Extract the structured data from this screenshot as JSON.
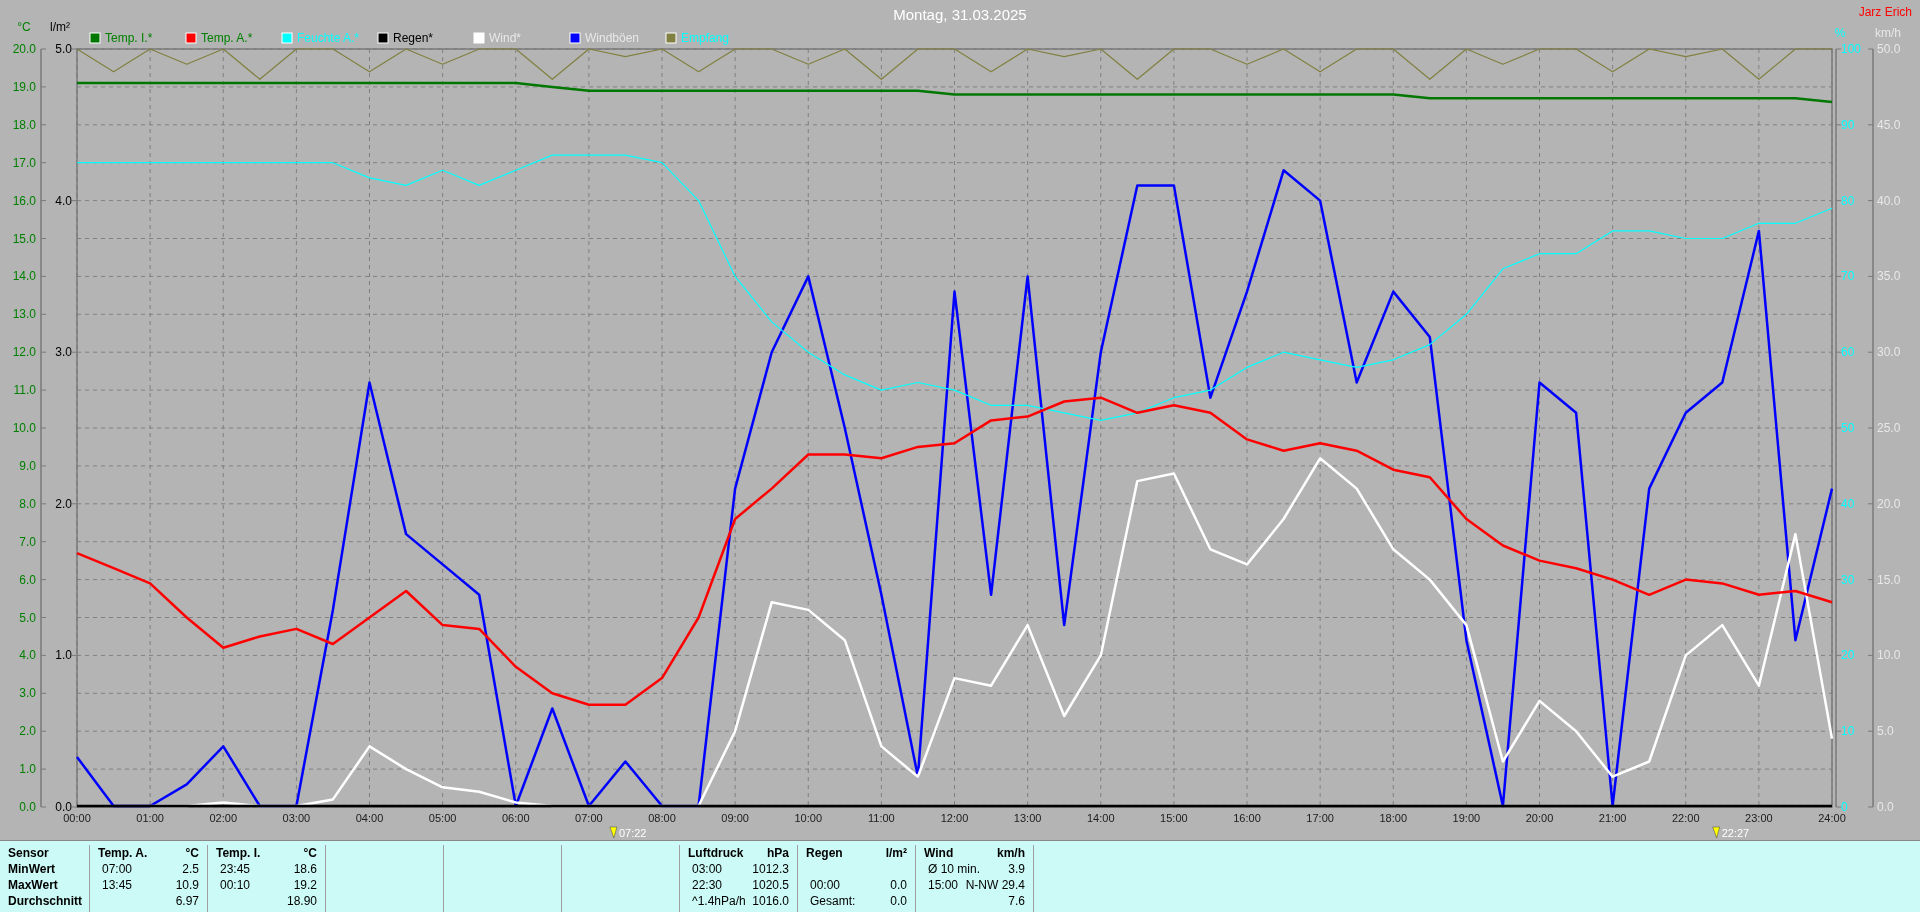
{
  "header": {
    "author": "Jarz Erich"
  },
  "chart_data": {
    "type": "line",
    "title": "Montag, 31.03.2025",
    "grid": true,
    "legend": "top",
    "x": [
      0,
      0.5,
      1,
      1.5,
      2,
      2.5,
      3,
      3.5,
      4,
      4.5,
      5,
      5.5,
      6,
      6.5,
      7,
      7.5,
      8,
      8.5,
      9,
      9.5,
      10,
      10.5,
      11,
      11.5,
      12,
      12.5,
      13,
      13.5,
      14,
      14.5,
      15,
      15.5,
      16,
      16.5,
      17,
      17.5,
      18,
      18.5,
      19,
      19.5,
      20,
      20.5,
      21,
      21.5,
      22,
      22.5,
      23,
      23.5,
      24
    ],
    "xlim": [
      0,
      24
    ],
    "xticks": [
      {
        "value": 0,
        "label": "00:00"
      },
      {
        "value": 1,
        "label": "01:00"
      },
      {
        "value": 2,
        "label": "02:00"
      },
      {
        "value": 3,
        "label": "03:00"
      },
      {
        "value": 4,
        "label": "04:00"
      },
      {
        "value": 5,
        "label": "05:00"
      },
      {
        "value": 6,
        "label": "06:00"
      },
      {
        "value": 7,
        "label": "07:00"
      },
      {
        "value": 8,
        "label": "08:00"
      },
      {
        "value": 9,
        "label": "09:00"
      },
      {
        "value": 10,
        "label": "10:00"
      },
      {
        "value": 11,
        "label": "11:00"
      },
      {
        "value": 12,
        "label": "12:00"
      },
      {
        "value": 13,
        "label": "13:00"
      },
      {
        "value": 14,
        "label": "14:00"
      },
      {
        "value": 15,
        "label": "15:00"
      },
      {
        "value": 16,
        "label": "16:00"
      },
      {
        "value": 17,
        "label": "17:00"
      },
      {
        "value": 18,
        "label": "18:00"
      },
      {
        "value": 19,
        "label": "19:00"
      },
      {
        "value": 20,
        "label": "20:00"
      },
      {
        "value": 21,
        "label": "21:00"
      },
      {
        "value": 22,
        "label": "22:00"
      },
      {
        "value": 23,
        "label": "23:00"
      },
      {
        "value": 24,
        "label": "24:00"
      }
    ],
    "ylabel": "°C",
    "ylim": [
      0,
      20
    ],
    "yticks": [
      {
        "value": 0,
        "label": "0.0"
      },
      {
        "value": 1,
        "label": "1.0"
      },
      {
        "value": 2,
        "label": "2.0"
      },
      {
        "value": 3,
        "label": "3.0"
      },
      {
        "value": 4,
        "label": "4.0"
      },
      {
        "value": 5,
        "label": "5.0"
      },
      {
        "value": 6,
        "label": "6.0"
      },
      {
        "value": 7,
        "label": "7.0"
      },
      {
        "value": 8,
        "label": "8.0"
      },
      {
        "value": 9,
        "label": "9.0"
      },
      {
        "value": 10,
        "label": "10.0"
      },
      {
        "value": 11,
        "label": "11.0"
      },
      {
        "value": 12,
        "label": "12.0"
      },
      {
        "value": 13,
        "label": "13.0"
      },
      {
        "value": 14,
        "label": "14.0"
      },
      {
        "value": 15,
        "label": "15.0"
      },
      {
        "value": 16,
        "label": "16.0"
      },
      {
        "value": 17,
        "label": "17.0"
      },
      {
        "value": 18,
        "label": "18.0"
      },
      {
        "value": 19,
        "label": "19.0"
      },
      {
        "value": 20,
        "label": "20.0"
      }
    ],
    "y2label": "%",
    "y2lim": [
      0,
      100
    ],
    "y2ticks": [
      {
        "value": 0,
        "label": "0"
      },
      {
        "value": 10,
        "label": "10"
      },
      {
        "value": 20,
        "label": "20"
      },
      {
        "value": 30,
        "label": "30"
      },
      {
        "value": 40,
        "label": "40"
      },
      {
        "value": 50,
        "label": "50"
      },
      {
        "value": 60,
        "label": "60"
      },
      {
        "value": 70,
        "label": "70"
      },
      {
        "value": 80,
        "label": "80"
      },
      {
        "value": 90,
        "label": "90"
      },
      {
        "value": 100,
        "label": "100"
      }
    ],
    "y3label": "km/h",
    "y3lim": [
      0,
      50
    ],
    "y3ticks": [
      {
        "value": 0,
        "label": "0.0"
      },
      {
        "value": 5,
        "label": "5.0"
      },
      {
        "value": 10,
        "label": "10.0"
      },
      {
        "value": 15,
        "label": "15.0"
      },
      {
        "value": 20,
        "label": "20.0"
      },
      {
        "value": 25,
        "label": "25.0"
      },
      {
        "value": 30,
        "label": "30.0"
      },
      {
        "value": 35,
        "label": "35.0"
      },
      {
        "value": 40,
        "label": "40.0"
      },
      {
        "value": 45,
        "label": "45.0"
      },
      {
        "value": 50,
        "label": "50.0"
      }
    ],
    "series": [
      {
        "name": "Temp. I.*",
        "color": "#007800",
        "values": [
          19.1,
          19.1,
          19.1,
          19.1,
          19.1,
          19.1,
          19.1,
          19.1,
          19.1,
          19.1,
          19.1,
          19.1,
          19.1,
          19.0,
          18.9,
          18.9,
          18.9,
          18.9,
          18.9,
          18.9,
          18.9,
          18.9,
          18.9,
          18.9,
          18.8,
          18.8,
          18.8,
          18.8,
          18.8,
          18.8,
          18.8,
          18.8,
          18.8,
          18.8,
          18.8,
          18.8,
          18.8,
          18.7,
          18.7,
          18.7,
          18.7,
          18.7,
          18.7,
          18.7,
          18.7,
          18.7,
          18.7,
          18.7,
          18.6
        ]
      },
      {
        "name": "Temp. A.*",
        "color": "#ff0000",
        "values": [
          6.7,
          6.3,
          5.9,
          5.0,
          4.2,
          4.5,
          4.7,
          4.3,
          5.0,
          5.7,
          4.8,
          4.7,
          3.7,
          3.0,
          2.7,
          2.7,
          3.4,
          5.0,
          7.6,
          8.4,
          9.3,
          9.3,
          9.2,
          9.5,
          9.6,
          10.2,
          10.3,
          10.7,
          10.8,
          10.4,
          10.6,
          10.4,
          9.7,
          9.4,
          9.6,
          9.4,
          8.9,
          8.7,
          7.6,
          6.9,
          6.5,
          6.3,
          6.0,
          5.6,
          6.0,
          5.9,
          5.6,
          5.7,
          5.4
        ]
      },
      {
        "name": "Feuchte A.*",
        "color": "#00ffff",
        "axis": "y2",
        "values": [
          85,
          85,
          85,
          85,
          85,
          85,
          85,
          85,
          83,
          82,
          84,
          82,
          84,
          86,
          86,
          86,
          85,
          80,
          70,
          64,
          60,
          57,
          55,
          56,
          55,
          53,
          53,
          52,
          51,
          52,
          54,
          55,
          58,
          60,
          59,
          58,
          59,
          61,
          65,
          71,
          73,
          73,
          76,
          76,
          75,
          75,
          77,
          77,
          79
        ]
      },
      {
        "name": "Regen*",
        "color": "#000000",
        "values": [
          0,
          0,
          0,
          0,
          0,
          0,
          0,
          0,
          0,
          0,
          0,
          0,
          0,
          0,
          0,
          0,
          0,
          0,
          0,
          0,
          0,
          0,
          0,
          0,
          0,
          0,
          0,
          0,
          0,
          0,
          0,
          0,
          0,
          0,
          0,
          0,
          0,
          0,
          0,
          0,
          0,
          0,
          0,
          0,
          0,
          0,
          0,
          0,
          0
        ]
      },
      {
        "name": "Wind*",
        "color": "#ffffff",
        "axis": "y3",
        "values": [
          null,
          null,
          0,
          0,
          0.3,
          0,
          0,
          0.5,
          4,
          2.5,
          1.3,
          1,
          0.3,
          0,
          0,
          0,
          0,
          0,
          5,
          13.5,
          13,
          11,
          4,
          2,
          8.5,
          8,
          12,
          6,
          10,
          21.5,
          22,
          17,
          16,
          19,
          23,
          21,
          17,
          15,
          12,
          3,
          7,
          5,
          2,
          3,
          10,
          12,
          8,
          18,
          4.5
        ]
      },
      {
        "name": "Windböen",
        "color": "#0000ff",
        "axis": "y3",
        "values": [
          3.3,
          0,
          0,
          1.5,
          4,
          0,
          0,
          13,
          28,
          18,
          16,
          14,
          0,
          6.5,
          0,
          3,
          0,
          0,
          21,
          30,
          35,
          25,
          14,
          2,
          34,
          14,
          35,
          12,
          30,
          41,
          41,
          27,
          34,
          42,
          40,
          28,
          34,
          31,
          11,
          0,
          28,
          26,
          0,
          21,
          26,
          28,
          38,
          11,
          21
        ]
      },
      {
        "name": "Empfang",
        "color": "#808040",
        "axis": "y2",
        "values": [
          100,
          97,
          100,
          98,
          100,
          96,
          100,
          100,
          97,
          100,
          98,
          100,
          100,
          96,
          100,
          99,
          100,
          97,
          100,
          100,
          98,
          100,
          96,
          100,
          100,
          97,
          100,
          99,
          100,
          96,
          100,
          100,
          98,
          100,
          97,
          100,
          100,
          96,
          100,
          98,
          100,
          100,
          97,
          100,
          99,
          100,
          96,
          100,
          100
        ]
      }
    ],
    "annotations": [
      "07:22",
      "22:27"
    ]
  },
  "rain_axis": {
    "label": "l/m²",
    "ticks": [
      "5.0",
      "4.0",
      "3.0",
      "2.0",
      "1.0",
      "0.0"
    ]
  },
  "table": {
    "corner": "Sensor",
    "row_labels": [
      "MinWert",
      "MaxWert",
      "Durchschnitt"
    ],
    "columns": [
      {
        "kind": "data",
        "heading": "Temp. A.",
        "unit": "°C",
        "rows": [
          {
            "time": "07:00",
            "value": "2.5"
          },
          {
            "time": "13:45",
            "value": "10.9"
          },
          {
            "value": "6.97"
          }
        ]
      },
      {
        "kind": "data",
        "heading": "Temp. I.",
        "unit": "°C",
        "rows": [
          {
            "time": "23:45",
            "value": "18.6"
          },
          {
            "time": "00:10",
            "value": "19.2"
          },
          {
            "value": "18.90"
          }
        ]
      },
      {
        "kind": "empty"
      },
      {
        "kind": "empty"
      },
      {
        "kind": "empty"
      },
      {
        "kind": "data",
        "heading": "Luftdruck",
        "unit": "hPa",
        "rows": [
          {
            "time": "03:00",
            "value": "1012.3"
          },
          {
            "time": "22:30",
            "value": "1020.5"
          },
          {
            "time": "^1.4hPa/h",
            "value": "1016.0"
          }
        ]
      },
      {
        "kind": "data",
        "heading": "Regen",
        "unit": "l/m²",
        "rows": [
          {},
          {
            "time": "00:00",
            "value": "0.0"
          },
          {
            "time": "Gesamt:",
            "value": "0.0"
          }
        ]
      },
      {
        "kind": "data",
        "heading": "Wind",
        "unit": "km/h",
        "rows": [
          {
            "time": "Ø 10 min.",
            "value": "3.9"
          },
          {
            "time": "15:00",
            "value": "N-NW 29.4"
          },
          {
            "value": "7.6"
          }
        ]
      }
    ]
  }
}
